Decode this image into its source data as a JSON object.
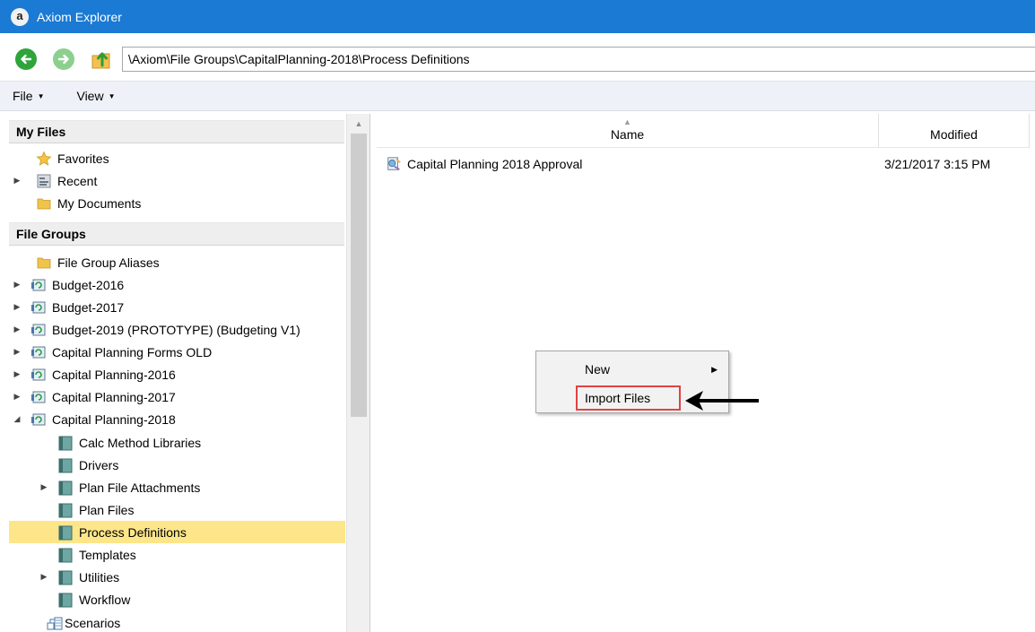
{
  "window": {
    "title": "Axiom Explorer",
    "app_icon_letter": "a"
  },
  "address_bar": {
    "path": "\\Axiom\\File Groups\\CapitalPlanning-2018\\Process Definitions"
  },
  "menu": {
    "file_label": "File",
    "view_label": "View"
  },
  "left_pane": {
    "my_files_header": "My Files",
    "my_files": [
      {
        "label": "Favorites",
        "icon": "star-icon"
      },
      {
        "label": "Recent",
        "icon": "recent-icon"
      },
      {
        "label": "My Documents",
        "icon": "folder-icon"
      }
    ],
    "file_groups_header": "File Groups",
    "file_groups": [
      {
        "label": "File Group Aliases",
        "icon": "folder-icon"
      },
      {
        "label": "Budget-2016",
        "icon": "file-group-icon"
      },
      {
        "label": "Budget-2017",
        "icon": "file-group-icon"
      },
      {
        "label": "Budget-2019 (PROTOTYPE) (Budgeting V1)",
        "icon": "file-group-icon"
      },
      {
        "label": "Capital Planning Forms OLD",
        "icon": "file-group-icon"
      },
      {
        "label": "Capital Planning-2016",
        "icon": "file-group-icon"
      },
      {
        "label": "Capital Planning-2017",
        "icon": "file-group-icon"
      },
      {
        "label": "Capital Planning-2018",
        "icon": "file-group-icon"
      }
    ],
    "capital_planning_2018_children": [
      {
        "label": "Calc Method Libraries",
        "icon": "library-icon"
      },
      {
        "label": "Drivers",
        "icon": "library-icon"
      },
      {
        "label": "Plan File Attachments",
        "icon": "library-icon"
      },
      {
        "label": "Plan Files",
        "icon": "library-icon"
      },
      {
        "label": "Process Definitions",
        "icon": "library-icon"
      },
      {
        "label": "Templates",
        "icon": "library-icon"
      },
      {
        "label": "Utilities",
        "icon": "library-icon"
      },
      {
        "label": "Workflow",
        "icon": "library-icon"
      },
      {
        "label": "Scenarios",
        "icon": "scenarios-icon"
      }
    ]
  },
  "file_list": {
    "columns": {
      "name": "Name",
      "modified": "Modified"
    },
    "rows": [
      {
        "name": "Capital Planning 2018 Approval",
        "modified": "3/21/2017 3:15 PM",
        "icon": "process-definition-icon"
      }
    ]
  },
  "context_menu": {
    "items": [
      {
        "label": "New",
        "has_submenu": true
      },
      {
        "label": "Import Files",
        "has_submenu": false
      }
    ]
  },
  "colors": {
    "titlebar": "#1a7ad4",
    "selection": "#fde68a",
    "highlight_box": "#e04343"
  }
}
